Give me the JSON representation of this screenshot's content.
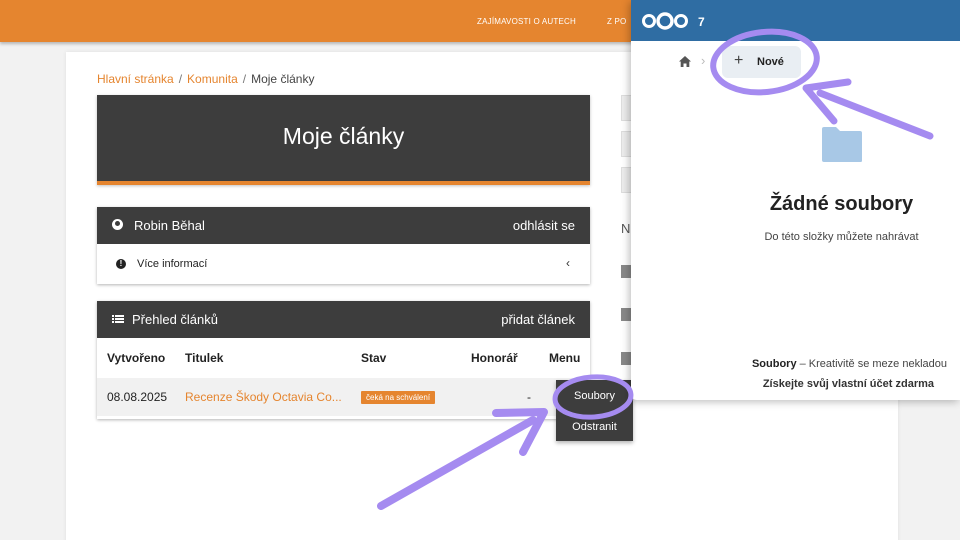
{
  "header": {
    "nav_items": [
      "ZAJÍMAVOSTI O AUTECH",
      "Z PO"
    ],
    "brand_color": "#e5852f"
  },
  "breadcrumb": {
    "home": "Hlavní stránka",
    "community": "Komunita",
    "current": "Moje články",
    "separator": "/"
  },
  "hero": {
    "title": "Moje články"
  },
  "user_panel": {
    "name": "Robin Běhal",
    "logout": "odhlásit se",
    "more_info": "Více informací",
    "chevron": "‹",
    "user_icon": "user-icon",
    "info_icon": "info-icon"
  },
  "articles_panel": {
    "title": "Přehled článků",
    "add": "přidat článek",
    "list_icon": "list-icon",
    "columns": {
      "created": "Vytvořeno",
      "title": "Titulek",
      "status": "Stav",
      "fee": "Honorář",
      "menu": "Menu"
    },
    "rows": [
      {
        "created": "08.08.2025",
        "title": "Recenze Škody Octavia Co...",
        "status": "čeká na schválení",
        "fee": "-"
      }
    ]
  },
  "row_menu": {
    "files": "Soubory",
    "delete": "Odstranit"
  },
  "sidebar_stub": {
    "letter": "N"
  },
  "nextcloud": {
    "header_count": "7",
    "header_color": "#2f6da3",
    "new_button": "Nové",
    "plus": "+",
    "home_icon": "home-icon",
    "crumb_separator": "›",
    "empty_title": "Žádné soubory",
    "empty_subtitle": "Do této složky můžete nahrávat",
    "footer_brand": "Soubory",
    "footer_tagline": " – Kreativitě se meze nekladou",
    "footer_cta": "Získejte svůj vlastní účet zdarma"
  },
  "annotation_color": "#a58bf0"
}
